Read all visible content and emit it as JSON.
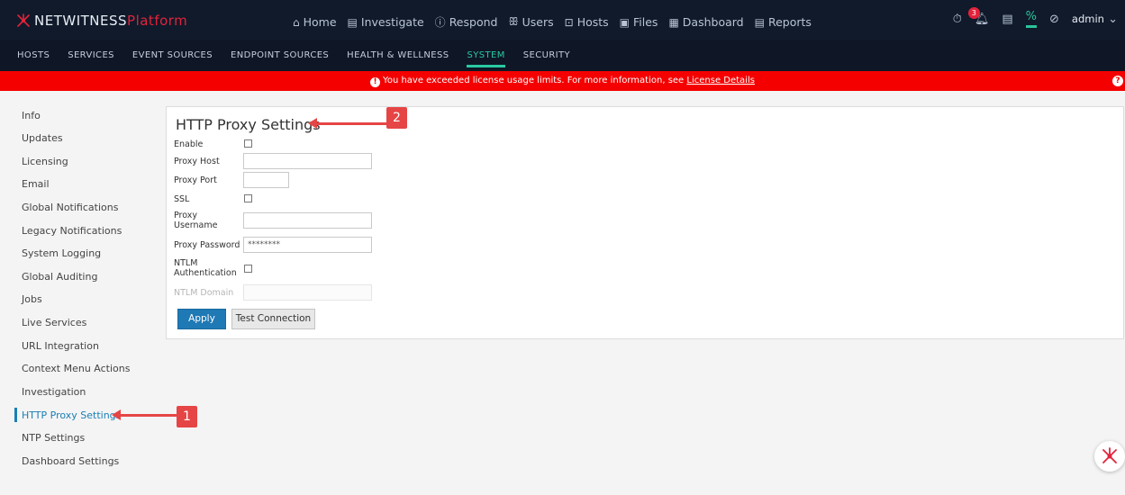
{
  "header": {
    "brand_main": "NETWITNESS",
    "brand_suffix": "Platform",
    "nav": [
      {
        "label": "Home",
        "icon": "home-icon",
        "glyph": "⌂"
      },
      {
        "label": "Investigate",
        "icon": "investigate-icon",
        "glyph": "▤"
      },
      {
        "label": "Respond",
        "icon": "respond-icon",
        "glyph": "ⓘ"
      },
      {
        "label": "Users",
        "icon": "users-icon",
        "glyph": "ꕥ"
      },
      {
        "label": "Hosts",
        "icon": "hosts-icon",
        "glyph": "⊡"
      },
      {
        "label": "Files",
        "icon": "files-icon",
        "glyph": "▣"
      },
      {
        "label": "Dashboard",
        "icon": "dashboard-icon",
        "glyph": "▦"
      },
      {
        "label": "Reports",
        "icon": "reports-icon",
        "glyph": "▤"
      }
    ],
    "notifications_count": "3",
    "admin_label": "admin"
  },
  "subnav": [
    "HOSTS",
    "SERVICES",
    "EVENT SOURCES",
    "ENDPOINT SOURCES",
    "HEALTH & WELLNESS",
    "SYSTEM",
    "SECURITY"
  ],
  "banner": {
    "text": "You have exceeded license usage limits. For more information, see",
    "link": "License Details"
  },
  "sidebar": {
    "items": [
      "Info",
      "Updates",
      "Licensing",
      "Email",
      "Global Notifications",
      "Legacy Notifications",
      "System Logging",
      "Global Auditing",
      "Jobs",
      "Live Services",
      "URL Integration",
      "Context Menu Actions",
      "Investigation",
      "HTTP Proxy Settings",
      "NTP Settings",
      "Dashboard Settings"
    ],
    "active": "HTTP Proxy Settings"
  },
  "panel": {
    "title": "HTTP Proxy Settings",
    "labels": {
      "enable": "Enable",
      "host": "Proxy Host",
      "port": "Proxy Port",
      "ssl": "SSL",
      "username_1": "Proxy",
      "username_2": "Username",
      "password": "Proxy Password",
      "ntlm_1": "NTLM",
      "ntlm_2": "Authentication",
      "ntlm_domain": "NTLM Domain"
    },
    "values": {
      "host": "",
      "port": "",
      "username": "",
      "password": "********",
      "ntlm_domain": ""
    },
    "buttons": {
      "apply": "Apply",
      "test": "Test Connection"
    }
  },
  "callouts": {
    "one": "1",
    "two": "2"
  },
  "colors": {
    "accent": "#2ac9a1",
    "banner": "#f40000",
    "primary": "#1f79b5",
    "callout": "#e64545"
  }
}
